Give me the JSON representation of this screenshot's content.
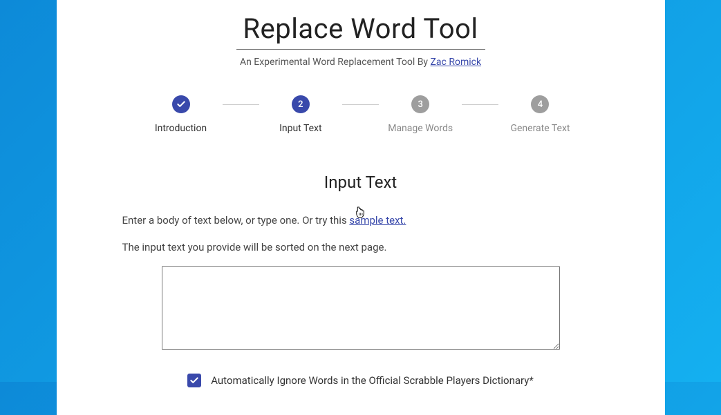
{
  "header": {
    "title": "Replace Word Tool",
    "subtitle_prefix": "An Experimental Word Replacement Tool By ",
    "author_link": "Zac Romick"
  },
  "stepper": {
    "steps": [
      {
        "label": "Introduction",
        "state": "done"
      },
      {
        "num": "2",
        "label": "Input Text",
        "state": "active"
      },
      {
        "num": "3",
        "label": "Manage Words",
        "state": "pending"
      },
      {
        "num": "4",
        "label": "Generate Text",
        "state": "pending"
      }
    ]
  },
  "main": {
    "section_title": "Input Text",
    "instruction_prefix": "Enter a body of text below, or type one. Or try this ",
    "sample_link": "sample text.",
    "note": "The input text you provide will be sorted on the next page.",
    "textarea_value": "",
    "checkbox_label": "Automatically Ignore Words in the Official Scrabble Players Dictionary*",
    "checkbox_checked": true
  }
}
